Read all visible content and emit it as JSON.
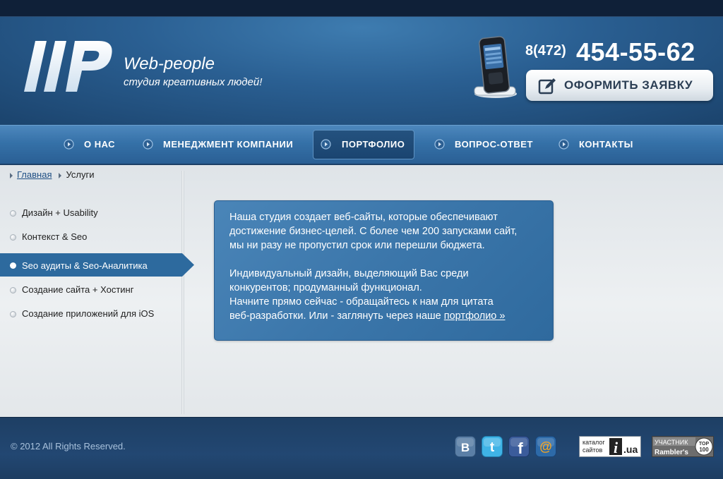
{
  "brand": {
    "logo_text": "ІІР",
    "name": "Web-people",
    "slogan": "студия креативных людей!"
  },
  "contact": {
    "phone_prefix": "8(472)",
    "phone_number": "454-55-62",
    "order_button_label": "ОФОРМИТЬ ЗАЯВКУ"
  },
  "nav": {
    "items": [
      {
        "label": "О НАС",
        "active": false
      },
      {
        "label": "МЕНЕДЖМЕНТ КОМПАНИИ",
        "active": false
      },
      {
        "label": "ПОРТФОЛИО",
        "active": true
      },
      {
        "label": "ВОПРОС-ОТВЕТ",
        "active": false
      },
      {
        "label": "КОНТАКТЫ",
        "active": false
      }
    ]
  },
  "breadcrumb": {
    "home": "Главная",
    "current": "Услуги"
  },
  "sidebar": {
    "items": [
      {
        "label": "Дизайн + Usability",
        "active": false
      },
      {
        "label": "Контекст & Seo",
        "active": false
      },
      {
        "label": "Seo аудиты & Seo-Аналитика",
        "active": true
      },
      {
        "label": "Создание сайта + Хостинг",
        "active": false
      },
      {
        "label": "Создание приложений для iOS",
        "active": false
      }
    ]
  },
  "info": {
    "para1": [
      "Наша студия создает веб-сайты, которые обеспечивают",
      "достижение бизнес-целей. С более чем 200 запусками сайт,",
      "мы ни разу не пропустил срок или перешли бюджета."
    ],
    "para2": [
      "Индивидуальный дизайн, выделяющий Вас среди",
      "конкурентов; продуманный функционал.",
      "Начните прямо сейчас - обращайтесь к нам для цитата"
    ],
    "last_line_prefix": "веб-разработки. Или - заглянуть через наше ",
    "portfolio_link": "портфолио »"
  },
  "footer": {
    "copyright": "© 2012  All Rights Reserved.",
    "social": {
      "vk_letter": "B",
      "twitter_letter": "t",
      "facebook_letter": "f",
      "mail_symbol": "@"
    },
    "catalog_badge": {
      "line1": "каталог",
      "line2": "сайтов",
      "mark": "i",
      "domain": ".ua"
    },
    "rambler_badge": {
      "line1": "УЧАСТНИК",
      "brand": "Rambler's",
      "top_line1": "TOP",
      "top_line2": "100"
    }
  },
  "colors": {
    "header_blue": "#2a5f92",
    "nav_blue": "#3571a8",
    "accent_blue": "#2d6a9e",
    "footer_blue": "#1e3f64",
    "info_box": "#3b76aa"
  }
}
